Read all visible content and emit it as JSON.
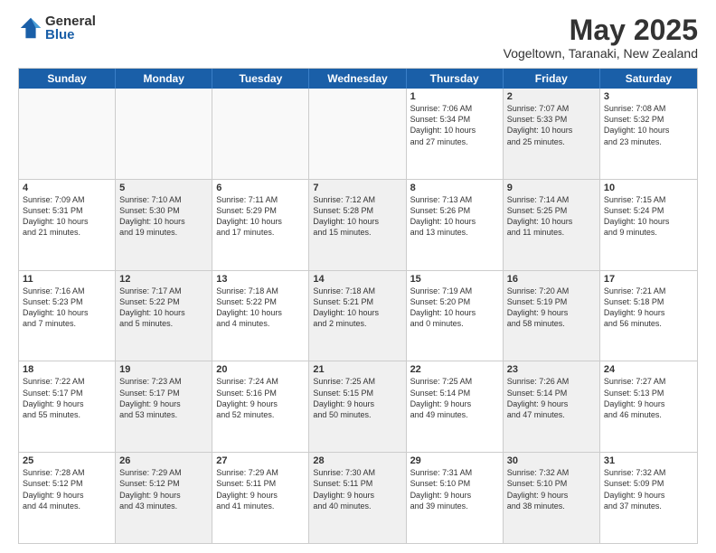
{
  "header": {
    "logo": {
      "general": "General",
      "blue": "Blue"
    },
    "title": "May 2025",
    "location": "Vogeltown, Taranaki, New Zealand"
  },
  "days_of_week": [
    "Sunday",
    "Monday",
    "Tuesday",
    "Wednesday",
    "Thursday",
    "Friday",
    "Saturday"
  ],
  "weeks": [
    [
      {
        "day": "",
        "info": "",
        "shaded": true
      },
      {
        "day": "",
        "info": "",
        "shaded": true
      },
      {
        "day": "",
        "info": "",
        "shaded": true
      },
      {
        "day": "",
        "info": "",
        "shaded": true
      },
      {
        "day": "1",
        "info": "Sunrise: 7:06 AM\nSunset: 5:34 PM\nDaylight: 10 hours\nand 27 minutes.",
        "shaded": false
      },
      {
        "day": "2",
        "info": "Sunrise: 7:07 AM\nSunset: 5:33 PM\nDaylight: 10 hours\nand 25 minutes.",
        "shaded": true
      },
      {
        "day": "3",
        "info": "Sunrise: 7:08 AM\nSunset: 5:32 PM\nDaylight: 10 hours\nand 23 minutes.",
        "shaded": false
      }
    ],
    [
      {
        "day": "4",
        "info": "Sunrise: 7:09 AM\nSunset: 5:31 PM\nDaylight: 10 hours\nand 21 minutes.",
        "shaded": false
      },
      {
        "day": "5",
        "info": "Sunrise: 7:10 AM\nSunset: 5:30 PM\nDaylight: 10 hours\nand 19 minutes.",
        "shaded": true
      },
      {
        "day": "6",
        "info": "Sunrise: 7:11 AM\nSunset: 5:29 PM\nDaylight: 10 hours\nand 17 minutes.",
        "shaded": false
      },
      {
        "day": "7",
        "info": "Sunrise: 7:12 AM\nSunset: 5:28 PM\nDaylight: 10 hours\nand 15 minutes.",
        "shaded": true
      },
      {
        "day": "8",
        "info": "Sunrise: 7:13 AM\nSunset: 5:26 PM\nDaylight: 10 hours\nand 13 minutes.",
        "shaded": false
      },
      {
        "day": "9",
        "info": "Sunrise: 7:14 AM\nSunset: 5:25 PM\nDaylight: 10 hours\nand 11 minutes.",
        "shaded": true
      },
      {
        "day": "10",
        "info": "Sunrise: 7:15 AM\nSunset: 5:24 PM\nDaylight: 10 hours\nand 9 minutes.",
        "shaded": false
      }
    ],
    [
      {
        "day": "11",
        "info": "Sunrise: 7:16 AM\nSunset: 5:23 PM\nDaylight: 10 hours\nand 7 minutes.",
        "shaded": false
      },
      {
        "day": "12",
        "info": "Sunrise: 7:17 AM\nSunset: 5:22 PM\nDaylight: 10 hours\nand 5 minutes.",
        "shaded": true
      },
      {
        "day": "13",
        "info": "Sunrise: 7:18 AM\nSunset: 5:22 PM\nDaylight: 10 hours\nand 4 minutes.",
        "shaded": false
      },
      {
        "day": "14",
        "info": "Sunrise: 7:18 AM\nSunset: 5:21 PM\nDaylight: 10 hours\nand 2 minutes.",
        "shaded": true
      },
      {
        "day": "15",
        "info": "Sunrise: 7:19 AM\nSunset: 5:20 PM\nDaylight: 10 hours\nand 0 minutes.",
        "shaded": false
      },
      {
        "day": "16",
        "info": "Sunrise: 7:20 AM\nSunset: 5:19 PM\nDaylight: 9 hours\nand 58 minutes.",
        "shaded": true
      },
      {
        "day": "17",
        "info": "Sunrise: 7:21 AM\nSunset: 5:18 PM\nDaylight: 9 hours\nand 56 minutes.",
        "shaded": false
      }
    ],
    [
      {
        "day": "18",
        "info": "Sunrise: 7:22 AM\nSunset: 5:17 PM\nDaylight: 9 hours\nand 55 minutes.",
        "shaded": false
      },
      {
        "day": "19",
        "info": "Sunrise: 7:23 AM\nSunset: 5:17 PM\nDaylight: 9 hours\nand 53 minutes.",
        "shaded": true
      },
      {
        "day": "20",
        "info": "Sunrise: 7:24 AM\nSunset: 5:16 PM\nDaylight: 9 hours\nand 52 minutes.",
        "shaded": false
      },
      {
        "day": "21",
        "info": "Sunrise: 7:25 AM\nSunset: 5:15 PM\nDaylight: 9 hours\nand 50 minutes.",
        "shaded": true
      },
      {
        "day": "22",
        "info": "Sunrise: 7:25 AM\nSunset: 5:14 PM\nDaylight: 9 hours\nand 49 minutes.",
        "shaded": false
      },
      {
        "day": "23",
        "info": "Sunrise: 7:26 AM\nSunset: 5:14 PM\nDaylight: 9 hours\nand 47 minutes.",
        "shaded": true
      },
      {
        "day": "24",
        "info": "Sunrise: 7:27 AM\nSunset: 5:13 PM\nDaylight: 9 hours\nand 46 minutes.",
        "shaded": false
      }
    ],
    [
      {
        "day": "25",
        "info": "Sunrise: 7:28 AM\nSunset: 5:12 PM\nDaylight: 9 hours\nand 44 minutes.",
        "shaded": false
      },
      {
        "day": "26",
        "info": "Sunrise: 7:29 AM\nSunset: 5:12 PM\nDaylight: 9 hours\nand 43 minutes.",
        "shaded": true
      },
      {
        "day": "27",
        "info": "Sunrise: 7:29 AM\nSunset: 5:11 PM\nDaylight: 9 hours\nand 41 minutes.",
        "shaded": false
      },
      {
        "day": "28",
        "info": "Sunrise: 7:30 AM\nSunset: 5:11 PM\nDaylight: 9 hours\nand 40 minutes.",
        "shaded": true
      },
      {
        "day": "29",
        "info": "Sunrise: 7:31 AM\nSunset: 5:10 PM\nDaylight: 9 hours\nand 39 minutes.",
        "shaded": false
      },
      {
        "day": "30",
        "info": "Sunrise: 7:32 AM\nSunset: 5:10 PM\nDaylight: 9 hours\nand 38 minutes.",
        "shaded": true
      },
      {
        "day": "31",
        "info": "Sunrise: 7:32 AM\nSunset: 5:09 PM\nDaylight: 9 hours\nand 37 minutes.",
        "shaded": false
      }
    ]
  ]
}
